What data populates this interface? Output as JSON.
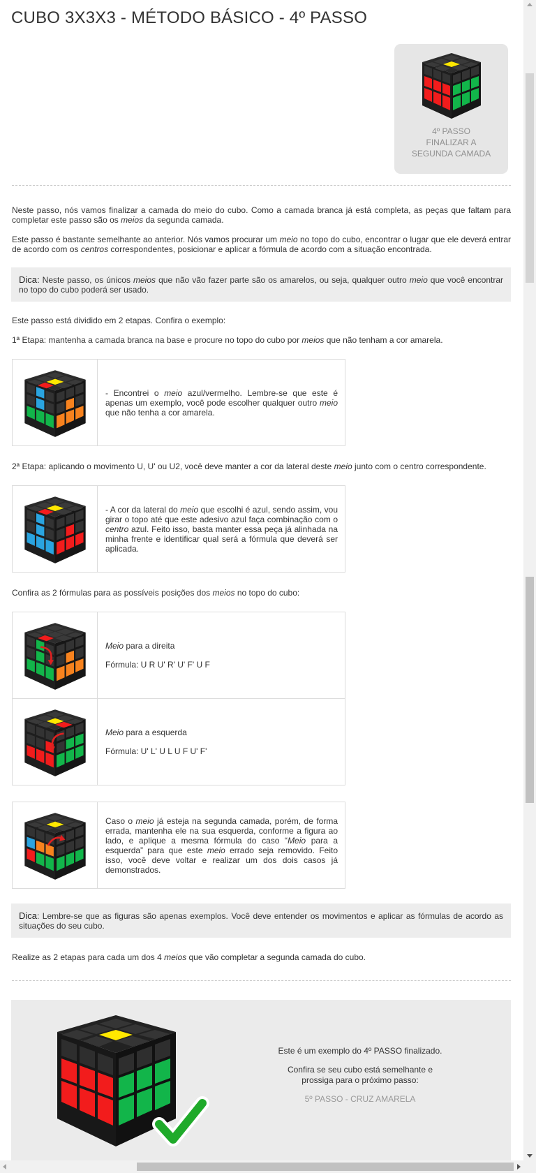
{
  "title": "CUBO 3X3X3 - MÉTODO BÁSICO - 4º PASSO",
  "step_card": {
    "line1": "4º PASSO",
    "line2": "FINALIZAR A",
    "line3": "SEGUNDA CAMADA"
  },
  "intro": {
    "p1_a": "Neste passo, nós vamos finalizar a camada do meio do cubo. Como a camada branca já está completa, as peças que faltam para completar este passo são os ",
    "p1_em": "meios",
    "p1_b": " da segunda camada.",
    "p2_a": "Este passo é bastante semelhante ao anterior. Nós vamos procurar um ",
    "p2_em1": "meio",
    "p2_b": " no topo do cubo, encontrar o lugar que ele deverá entrar de acordo com os ",
    "p2_em2": "centros",
    "p2_c": " correspondentes, posicionar e aplicar a fórmula de acordo com a situação encontrada."
  },
  "tip1": {
    "label": "Dica:",
    "a": " Neste passo, os únicos ",
    "em1": "meios",
    "b": " que não vão fazer parte são os amarelos, ou seja, qualquer outro ",
    "em2": "meio",
    "c": " que você encontrar no topo do cubo poderá ser usado."
  },
  "stages_intro": "Este passo está dividido em 2 etapas. Confira o exemplo:",
  "stage1": {
    "a": "1ª Etapa: mantenha a camada branca na base e procure no topo do cubo por ",
    "em": "meios",
    "b": " que não tenham a cor amarela."
  },
  "box1": {
    "a": "- Encontrei o ",
    "em1": "meio",
    "b": " azul/vermelho. Lembre-se que este é apenas um exemplo, você pode escolher qualquer outro ",
    "em2": "meio",
    "c": " que não tenha a cor amarela."
  },
  "stage2": {
    "a": "2ª Etapa: aplicando o movimento U, U' ou U2, você deve manter a cor da lateral deste ",
    "em": "meio",
    "b": " junto com o centro correspondente."
  },
  "box2": {
    "a": "- A cor da lateral do ",
    "em1": "meio",
    "b": " que escolhi é azul, sendo assim, vou girar o topo até que este adesivo azul faça combinação com o ",
    "em2": "centro",
    "c": " azul. Feito isso, basta manter essa peça já alinhada na minha frente e identificar qual será a fórmula que deverá ser aplicada."
  },
  "formulas_intro": {
    "a": "Confira as 2 fórmulas para as possíveis posições dos ",
    "em": "meios",
    "b": " no topo do cubo:"
  },
  "formulas": [
    {
      "em": "Meio",
      "label": " para a direita",
      "formula": "Fórmula: U R U' R' U' F' U F"
    },
    {
      "em": "Meio",
      "label": " para a esquerda",
      "formula": "Fórmula: U' L' U L U F U' F'"
    }
  ],
  "box3": {
    "a": "Caso o ",
    "em1": "meio",
    "b": " já esteja na segunda camada, porém, de forma errada, mantenha ele na sua esquerda, conforme a figura ao lado, e aplique a mesma fórmula do caso “",
    "em2": "Meio",
    "c": " para a esquerda” para que este ",
    "em3": "meio",
    "d": " errado seja removido. Feito isso, você deve voltar e realizar um dos dois casos já demonstrados."
  },
  "tip2": {
    "label": "Dica",
    "text": ": Lembre-se que as figuras são apenas exemplos. Você deve entender os movimentos e aplicar as fórmulas de acordo as situações do seu cubo."
  },
  "repeat": {
    "a": "Realize as 2 etapas para cada um dos 4 ",
    "em": "meios",
    "b": " que vão completar a segunda camada do cubo."
  },
  "final": {
    "line1": "Este é um exemplo do 4º PASSO finalizado.",
    "line2": "Confira se seu cubo está semelhante e",
    "line3": "prossiga para o próximo passo:",
    "link": "5º PASSO - CRUZ AMARELA"
  },
  "colors": {
    "red": "#f21c1c",
    "green": "#12b54a",
    "yellow": "#ffe800",
    "blue": "#2aa4e0",
    "orange": "#f7821e",
    "check": "#1faa2a"
  }
}
